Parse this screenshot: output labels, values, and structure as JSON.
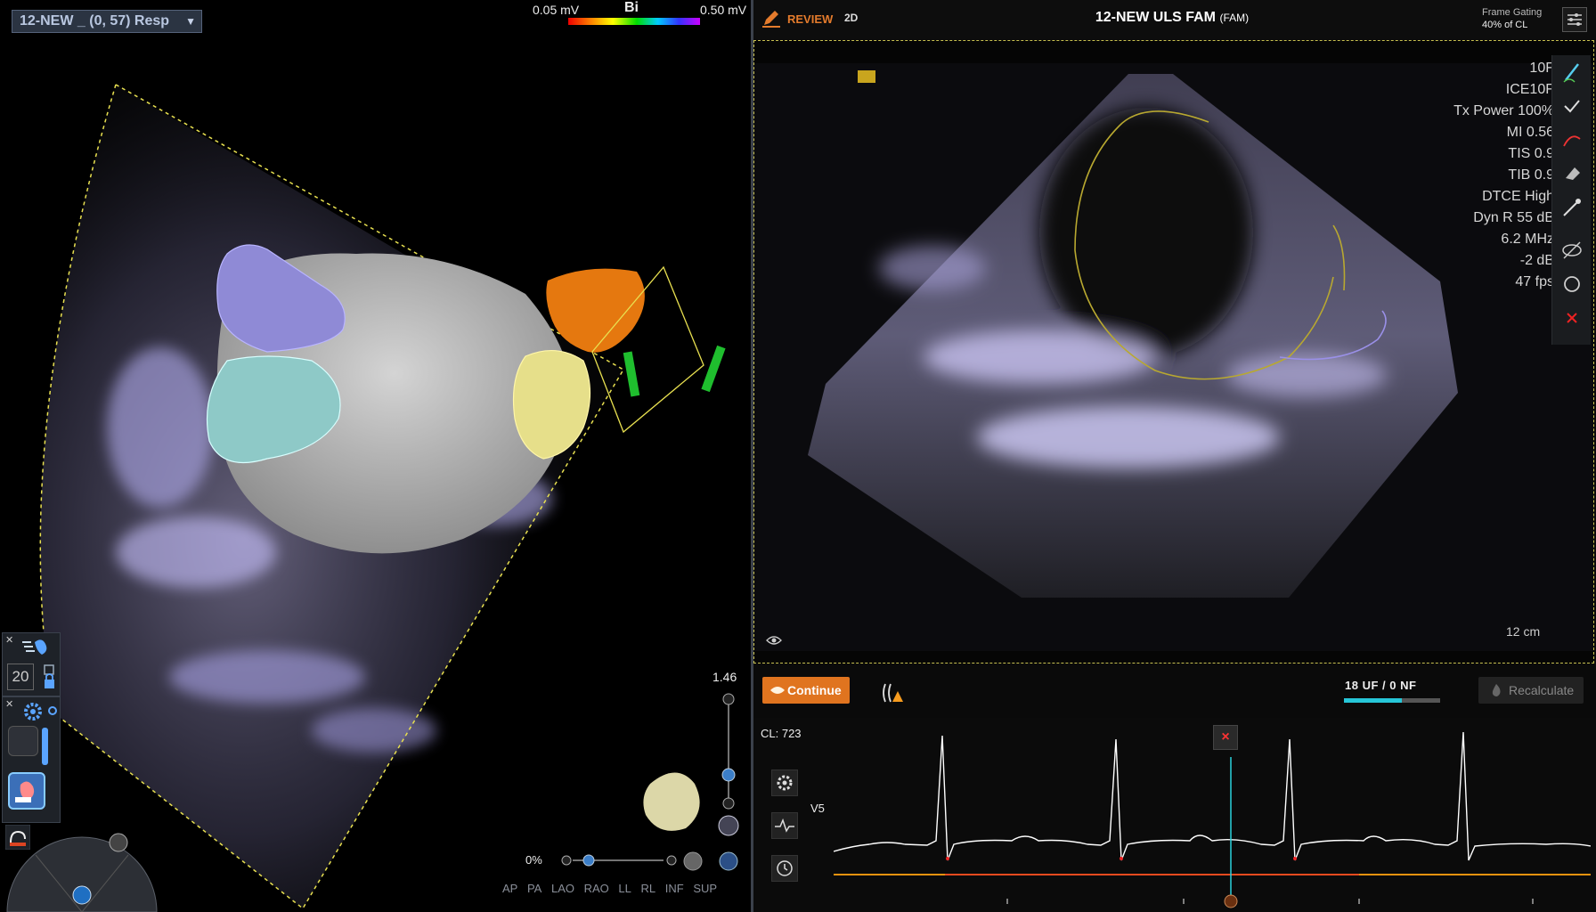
{
  "left_view": {
    "map_select": "12-NEW _ (0, 57) Resp",
    "scale": {
      "min": "0.05 mV",
      "mode": "Bi",
      "max": "0.50 mV"
    },
    "zoom_value": "1.46",
    "opacity_value": "0%",
    "panel_zoom": "20",
    "view_buttons": [
      "AP",
      "PA",
      "LAO",
      "RAO",
      "LL",
      "RL",
      "INF",
      "SUP"
    ],
    "colors": {
      "mesh": "#b9b9b9",
      "lavender": "#8f8ad6",
      "cyan": "#8ec9c7",
      "orange": "#e5780f",
      "yellow": "#e6df8a",
      "catheter": "#1fbe2e",
      "sector_line": "#e8e050"
    }
  },
  "right_view": {
    "review_label": "REVIEW",
    "mode_label": "2D",
    "title": "12-NEW ULS FAM",
    "title_suffix": "(FAM)",
    "frame_gating_label": "Frame Gating",
    "frame_gating_value": "40% of CL",
    "us_params": [
      "10F",
      "ICE10F",
      "Tx Power 100%",
      "MI 0.56",
      "TIS 0.9",
      "TIB 0.9",
      "DTCE High",
      "Dyn R 55 dB",
      "6.2 MHz",
      "-2 dB",
      "47 fps"
    ],
    "depth": "12 cm",
    "continue_label": "Continue",
    "frames_count": "18  UF / 0  NF",
    "frames_fraction": 0.6,
    "recalc_label": "Recalculate",
    "cl_label": "CL: 723",
    "lead_label": "V5",
    "ecg_close": "×",
    "colors": {
      "accent": "#e0741f",
      "progress": "#26c6d8",
      "ecg_line": "#ffffff",
      "marker": "#2ad1dd"
    }
  }
}
